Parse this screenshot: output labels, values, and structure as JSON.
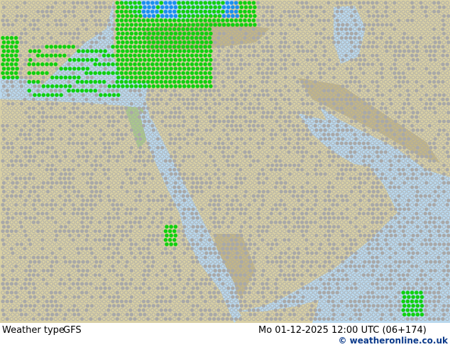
{
  "footer": {
    "title": "Weather type",
    "model": "GFS",
    "time": "Mo 01-12-2025 12:00 UTC (06+174)",
    "credit": "© weatheronline.co.uk"
  },
  "colors": {
    "sea": "#b9d8ee",
    "land": "#d8cfa4",
    "land_green": "#a9c98a",
    "mountain": "#c2b587",
    "cloud_symbol": "#a8a8a8",
    "rain_symbol": "#10d010",
    "snow_symbol": "#1a8ff0",
    "credit": "#0b3a8a"
  },
  "legend_icons": {
    "cloud": "cloud-icon",
    "rain": "rain-shower-icon",
    "snow": "snow-icon"
  }
}
